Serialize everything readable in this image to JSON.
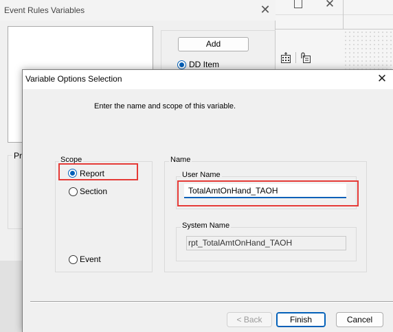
{
  "background_window": {
    "title": "Event Rules Variables",
    "close_glyph": "✕",
    "add_button": "Add",
    "radio_label": "DD Item",
    "group_label": "Pr"
  },
  "third_window": {
    "close_glyph": "✕",
    "icons": [
      "calculator-icon",
      "attach-icon"
    ]
  },
  "dialog": {
    "title": "Variable Options Selection",
    "close_glyph": "✕",
    "instruction": "Enter the name and scope of this variable.",
    "scope": {
      "label": "Scope",
      "options": [
        "Report",
        "Section",
        "Event"
      ],
      "selected": "Report"
    },
    "name": {
      "label": "Name",
      "user_name_label": "User Name",
      "user_name_value": "TotalAmtOnHand_TAOH",
      "system_name_label": "System Name",
      "system_name_value": "rpt_TotalAmtOnHand_TAOH"
    },
    "buttons": {
      "back": "< Back",
      "finish": "Finish",
      "cancel": "Cancel"
    },
    "highlight_color": "#e53935",
    "accent_color": "#005fb8"
  }
}
